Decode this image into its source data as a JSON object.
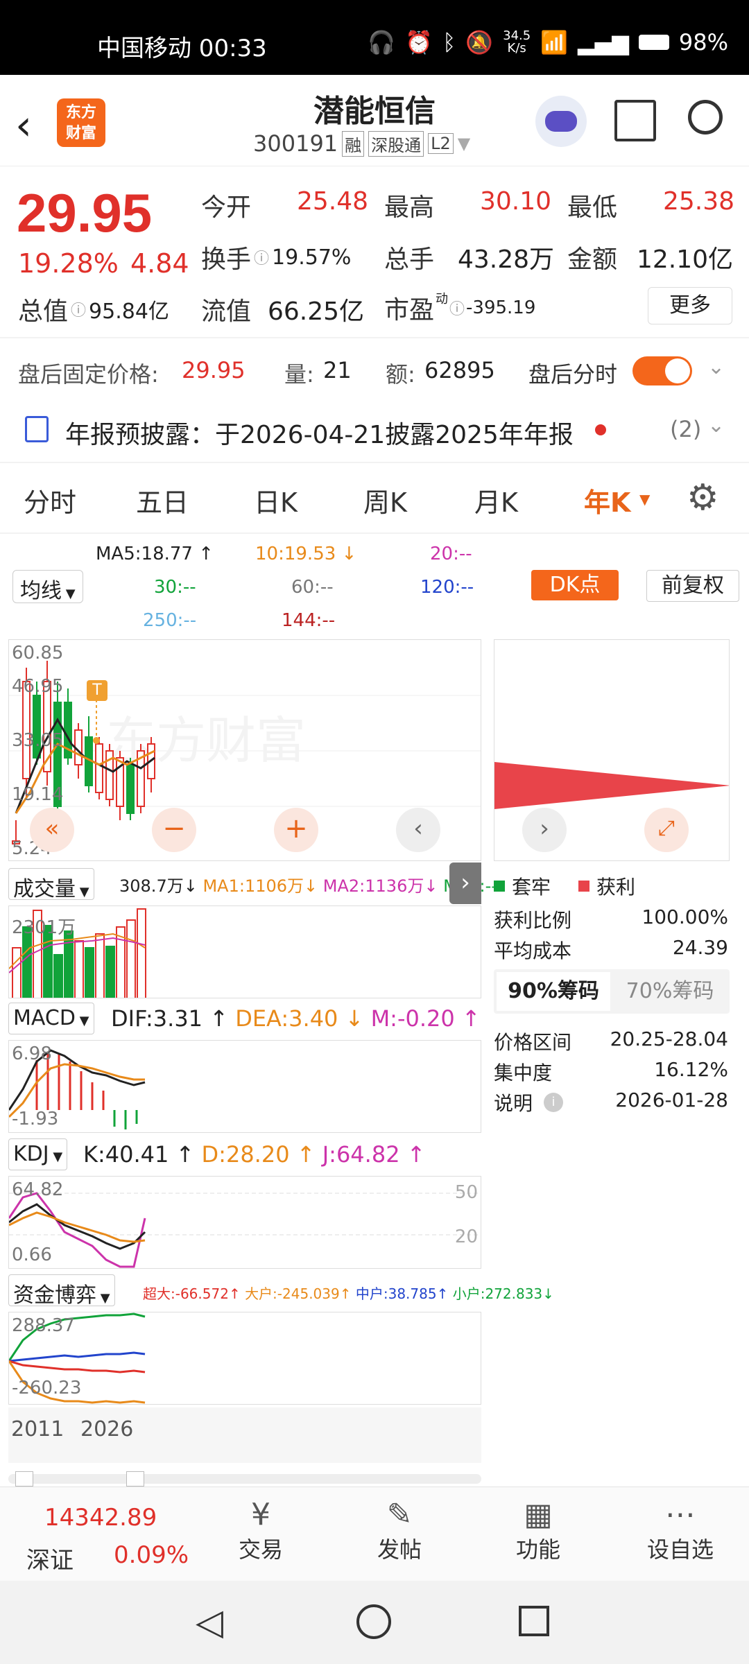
{
  "status_bar": {
    "carrier_time": "中国移动 00:33",
    "net_speed_top": "34.5",
    "net_speed_bottom": "K/s",
    "battery": "98%"
  },
  "header": {
    "stock_name": "潜能恒信",
    "stock_code": "300191",
    "tag_margin": "融",
    "tag_connect": "深股通",
    "tag_level": "L2",
    "logo_text_top": "东方",
    "logo_text_bottom": "财富"
  },
  "quote": {
    "price": "29.95",
    "change_pct": "19.28%",
    "change_val": "4.84",
    "open_label": "今开",
    "open": "25.48",
    "high_label": "最高",
    "high": "30.10",
    "low_label": "最低",
    "low": "25.38",
    "turnover_label": "换手",
    "turnover": "19.57%",
    "volume_label": "总手",
    "volume": "43.28万",
    "amount_label": "金额",
    "amount": "12.10亿",
    "mcap_label": "总值",
    "mcap": "95.84亿",
    "float_label": "流值",
    "float_mcap": "66.25亿",
    "pe_label": "市盈",
    "pe_super": "动",
    "pe": "-395.19",
    "more_button": "更多"
  },
  "after_hours": {
    "label": "盘后固定价格:",
    "price": "29.95",
    "vol_label": "量:",
    "vol": "21",
    "amt_label": "额:",
    "amt": "62895",
    "toggle_label": "盘后分时",
    "toggle_on": true
  },
  "notice": {
    "text": "年报预披露：于2026-04-21披露2025年年报",
    "count": "(2)"
  },
  "tabs": [
    "分时",
    "五日",
    "日K",
    "周K",
    "月K",
    "年K"
  ],
  "active_tab": "年K",
  "ma": {
    "ma5": "MA5:18.77",
    "ma10": "10:19.53",
    "ma20": "20:--",
    "ma30": "30:--",
    "ma60": "60:--",
    "ma120": "120:--",
    "ma250": "250:--",
    "ma144": "144:--",
    "selector": "均线",
    "dk_button": "DK点",
    "adjust_button": "前复权"
  },
  "kline": {
    "y_labels": [
      "60.85",
      "46.95",
      "33.05",
      "19.14",
      "5.24"
    ],
    "marker": "T",
    "watermark": "东方财富"
  },
  "chips": {
    "legend_trapped": "套牢",
    "legend_profit": "获利",
    "profit_ratio_label": "获利比例",
    "profit_ratio": "100.00%",
    "avg_cost_label": "平均成本",
    "avg_cost": "24.39",
    "tab_90": "90%筹码",
    "tab_70": "70%筹码",
    "range_label": "价格区间",
    "range": "20.25-28.04",
    "concentration_label": "集中度",
    "concentration": "16.12%",
    "note_label": "说明",
    "note": "2026-01-28"
  },
  "volume": {
    "selector": "成交量",
    "value": "308.7万",
    "ma1": "MA1:1106万",
    "ma2": "MA2:1136万",
    "ma3": "MA3:--",
    "y_label": "2301万"
  },
  "macd": {
    "selector": "MACD",
    "dif": "DIF:3.31",
    "dea": "DEA:3.40",
    "m": "M:-0.20",
    "y_top": "6.98",
    "y_bottom": "-1.93"
  },
  "kdj": {
    "selector": "KDJ",
    "k": "K:40.41",
    "d": "D:28.20",
    "j": "J:64.82",
    "y_top": "64.82",
    "y_bottom": "0.66",
    "ref_high": "50",
    "ref_low": "20"
  },
  "funds": {
    "selector": "资金博弈",
    "super": "超大:-66.572",
    "large": "大户:-245.039",
    "medium": "中户:38.785",
    "small": "小户:272.833",
    "y_top": "288.37",
    "y_bottom": "-260.23"
  },
  "x_axis": [
    "2011",
    "2026"
  ],
  "bottom_nav": {
    "index_value": "14342.89",
    "index_name": "深证",
    "index_pct": "0.09%",
    "items": [
      "交易",
      "发帖",
      "功能",
      "设自选"
    ]
  },
  "colors": {
    "up": "#e0302a",
    "down": "#11a33a",
    "accent": "#f4661b"
  }
}
